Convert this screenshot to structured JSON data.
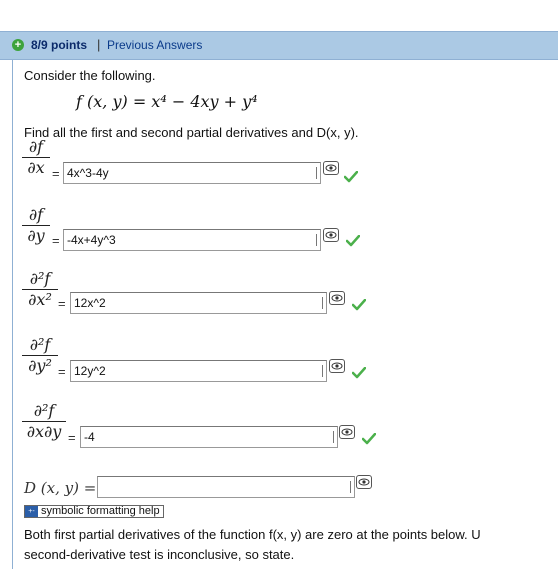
{
  "header": {
    "points": "8/9 points",
    "separator": "|",
    "previous_answers": "Previous Answers"
  },
  "prompt": "Consider the following.",
  "function_def": "f (x, y) = x⁴ − 4xy + y⁴",
  "instruction": "Find all the first and second partial derivatives and D(x, y).",
  "equals": "=",
  "derivatives": [
    {
      "num": "∂f",
      "den": "∂x",
      "value": "4x^3-4y",
      "correct": true
    },
    {
      "num": "∂f",
      "den": "∂y",
      "value": "-4x+4y^3",
      "correct": true
    },
    {
      "num": "∂²f",
      "den": "∂x²",
      "value": "12x^2",
      "correct": true
    },
    {
      "num": "∂²f",
      "den": "∂y²",
      "value": "12y^2",
      "correct": true
    },
    {
      "num": "∂²f",
      "den": "∂x∂y",
      "value": "-4",
      "correct": true
    }
  ],
  "d_label": "D (x, y) =",
  "d_value": "",
  "symbolic_help": "symbolic formatting help",
  "conclusion_line1": "Both first partial derivatives of the function f(x, y) are zero at the points below. U",
  "conclusion_line2": "second-derivative test is inconclusive, so state.",
  "colors": {
    "header_bg": "#abc9e4",
    "check": "#4bb04b",
    "plus": "#3da33d"
  },
  "icons": {
    "add": "plus-icon",
    "preview": "eye-icon",
    "correct": "check-icon",
    "help": "symbolic-icon"
  }
}
